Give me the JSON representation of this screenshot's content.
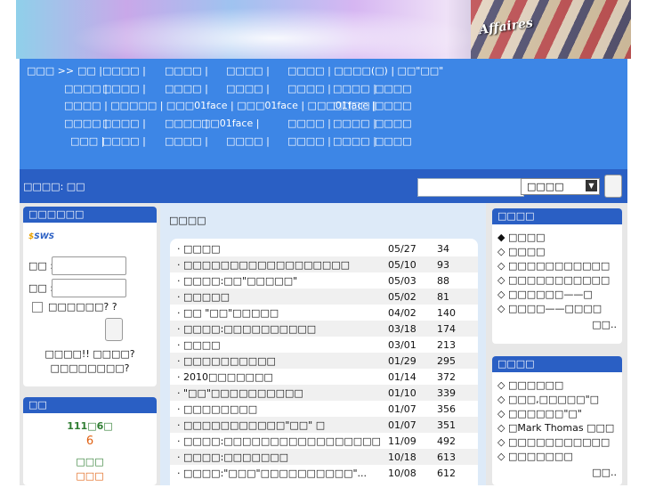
{
  "banner": {
    "magazine_text": "Affaires"
  },
  "nav": {
    "home": "□□□ >>",
    "rows": [
      [
        "□□ |",
        "□□□□ |",
        "□□□□ |",
        "□□□□ |",
        "□□□□ | □□□□(□) | □□\"□□\""
      ],
      [
        "□□□□ |",
        "□□□□ |",
        "□□□□ |",
        "□□□□ |",
        "□□□□ |",
        "□□□□ |",
        "□□□□"
      ],
      [
        "□□□□ | □□□□□ | □□□01face | □□□01face | □□□01face |",
        "□□□□ |",
        "□□□□"
      ],
      [
        "□□□□ |",
        "□□□□ |",
        "□□□□ |",
        "□□01face |",
        "□□□□ |",
        "□□□□ |",
        "□□□□"
      ],
      [
        "□□□ |",
        "□□□□ |",
        "□□□□ |",
        "□□□□ |",
        "□□□□ |",
        "□□□□ |",
        "□□□□"
      ]
    ]
  },
  "location": "□□□□: □□",
  "search": {
    "placeholder": "",
    "select_value": "□□□□"
  },
  "login": {
    "title": "□□□□□□",
    "logo_text": "SWS",
    "user_label": "□□ :",
    "pass_label": "□□ :",
    "remember": "□□□□□□? ?",
    "link1": "□□□□!! □□□□?",
    "link2": "□□□□□□□□?"
  },
  "stats": {
    "title": "□□",
    "line1": "111□6□",
    "line2": "6",
    "line3": "□□□",
    "line4": "□□□"
  },
  "main": {
    "title": "□□□□",
    "items": [
      {
        "title": "· □□□□",
        "date": "05/27",
        "count": "34"
      },
      {
        "title": "· □□□□□□□□□□□□□□□□□□",
        "date": "05/10",
        "count": "93"
      },
      {
        "title": "· □□□□:□□\"□□□□□\"",
        "date": "05/03",
        "count": "88"
      },
      {
        "title": "· □□□□□",
        "date": "05/02",
        "count": "81"
      },
      {
        "title": "· □□ \"□□\"□□□□□",
        "date": "04/02",
        "count": "140"
      },
      {
        "title": "· □□□□:□□□□□□□□□□",
        "date": "03/18",
        "count": "174"
      },
      {
        "title": "· □□□□",
        "date": "03/01",
        "count": "213"
      },
      {
        "title": "· □□□□□□□□□□",
        "date": "01/29",
        "count": "295"
      },
      {
        "title": "· 2010□□□□□□□",
        "date": "01/14",
        "count": "372"
      },
      {
        "title": "· \"□□\"□□□□□□□□□□",
        "date": "01/10",
        "count": "339"
      },
      {
        "title": "· □□□□□□□□",
        "date": "01/07",
        "count": "356"
      },
      {
        "title": "· □□□□□□□□□□□\"□□\" □",
        "date": "01/07",
        "count": "351"
      },
      {
        "title": "· □□□□:□□□□□□□□□□□□□□□□□",
        "date": "11/09",
        "count": "492"
      },
      {
        "title": "· □□□□:□□□□□□□",
        "date": "10/18",
        "count": "613"
      },
      {
        "title": "· □□□□:\"□□□\"□□□□□□□□□□\"...",
        "date": "10/08",
        "count": "612"
      }
    ]
  },
  "right1": {
    "title": "□□□□",
    "items": [
      "◆ □□□□",
      "◇ □□□□",
      "◇ □□□□□□□□□□□",
      "◇ □□□□□□□□□□□",
      "◇ □□□□□□——□",
      "◇ □□□□——□□□□"
    ],
    "more": "□□.."
  },
  "right2": {
    "title": "□□□□",
    "items": [
      "◇ □□□□□□",
      "◇ □□□,□□□□□\"□",
      "◇ □□□□□□\"□\"",
      "◇ □Mark Thomas □□□",
      "◇ □□□□□□□□□□□",
      "◇ □□□□□□□"
    ],
    "more": "□□.."
  }
}
